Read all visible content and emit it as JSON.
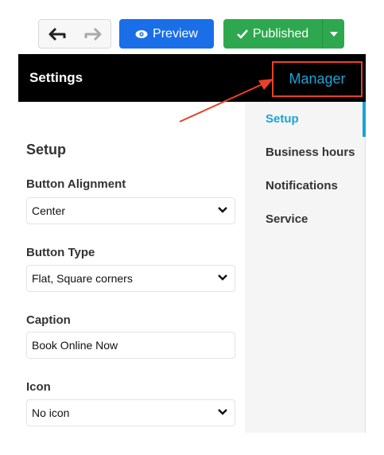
{
  "toolbar": {
    "preview_label": "Preview",
    "published_label": "Published"
  },
  "header": {
    "title": "Settings",
    "manager_label": "Manager"
  },
  "panel": {
    "section_title": "Setup",
    "fields": [
      {
        "label": "Button Alignment",
        "value": "Center"
      },
      {
        "label": "Button Type",
        "value": "Flat, Square corners"
      },
      {
        "label": "Caption",
        "value": "Book Online Now"
      },
      {
        "label": "Icon",
        "value": "No icon"
      }
    ]
  },
  "menu": {
    "items": [
      "Setup",
      "Business hours",
      "Notifications",
      "Service"
    ]
  },
  "colors": {
    "preview": "#1a6ee8",
    "published": "#2ea84f",
    "accent": "#1aa3d6",
    "annotation": "#e8402a"
  }
}
